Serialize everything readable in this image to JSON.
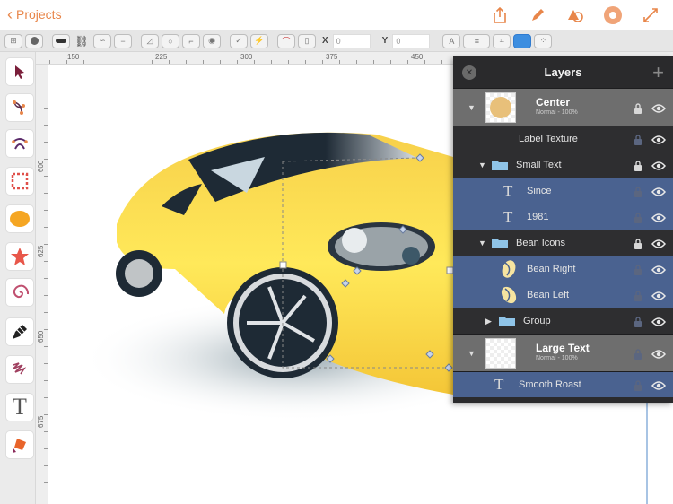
{
  "nav": {
    "back_label": "Projects",
    "icons": [
      "share-icon",
      "pencil-icon",
      "shapes-icon",
      "settings-icon",
      "expand-icon"
    ],
    "accent": "#e8864a"
  },
  "toolbar": {
    "x_label": "X",
    "x_value": "0",
    "y_label": "Y",
    "y_value": "0"
  },
  "rulers": {
    "horizontal": [
      "150",
      "225",
      "300",
      "375",
      "450"
    ],
    "vertical": [
      "600",
      "625",
      "650",
      "675"
    ]
  },
  "tools": [
    "select-tool",
    "node-tool",
    "pen-tool",
    "rectangle-tool",
    "ellipse-tool",
    "star-tool",
    "spiral-tool",
    "pencil-tool",
    "brush-tool",
    "text-tool",
    "fill-tool"
  ],
  "layers": {
    "title": "Layers",
    "rows": [
      {
        "label": "Center",
        "sub": "Normal - 100%",
        "kind": "group"
      },
      {
        "label": "Label Texture",
        "kind": "dark"
      },
      {
        "label": "Small Text",
        "kind": "dark",
        "type": "folder"
      },
      {
        "label": "Since",
        "kind": "sel",
        "type": "text"
      },
      {
        "label": "1981",
        "kind": "sel",
        "type": "text"
      },
      {
        "label": "Bean Icons",
        "kind": "dark",
        "type": "folder"
      },
      {
        "label": "Bean Right",
        "kind": "sel",
        "type": "bean"
      },
      {
        "label": "Bean Left",
        "kind": "sel",
        "type": "bean"
      },
      {
        "label": "Group",
        "kind": "dark",
        "type": "folder"
      },
      {
        "label": "Large Text",
        "sub": "Normal - 100%",
        "kind": "group"
      },
      {
        "label": "Smooth Roast",
        "kind": "sel",
        "type": "text"
      }
    ]
  }
}
